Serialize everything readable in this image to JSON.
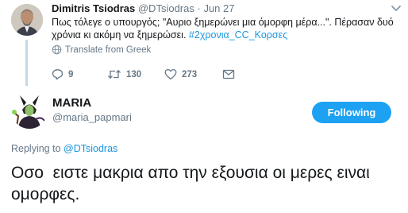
{
  "parent_tweet": {
    "display_name": "Dimitris Tsiodras",
    "handle": "@DTsiodras",
    "separator": "·",
    "date": "Jun 27",
    "text": "Πως τόλεγε ο υπουργός; \"Αυριο ξημερώνει μια όμορφη μέρα...\". Πέρασαν δυό χρόνια κι ακόμη να ξημερώσει.",
    "hashtag": "#2χρονια_CC_Κορσες",
    "translate_label": "Translate from Greek",
    "actions": {
      "replies": "9",
      "retweets": "130",
      "likes": "273"
    }
  },
  "reply_tweet": {
    "display_name": "MARIA",
    "handle": "@maria_papmari",
    "follow_label": "Following",
    "replying_prefix": "Replying to",
    "replying_to": "@DTsiodras",
    "text": "Οσο  ειστε μακρια απο την εξουσια οι μερες ειναι ομορφες."
  },
  "colors": {
    "accent": "#1da1f2",
    "link": "#1b95e0",
    "muted": "#657786",
    "thread_line": "#c4d8e6"
  }
}
